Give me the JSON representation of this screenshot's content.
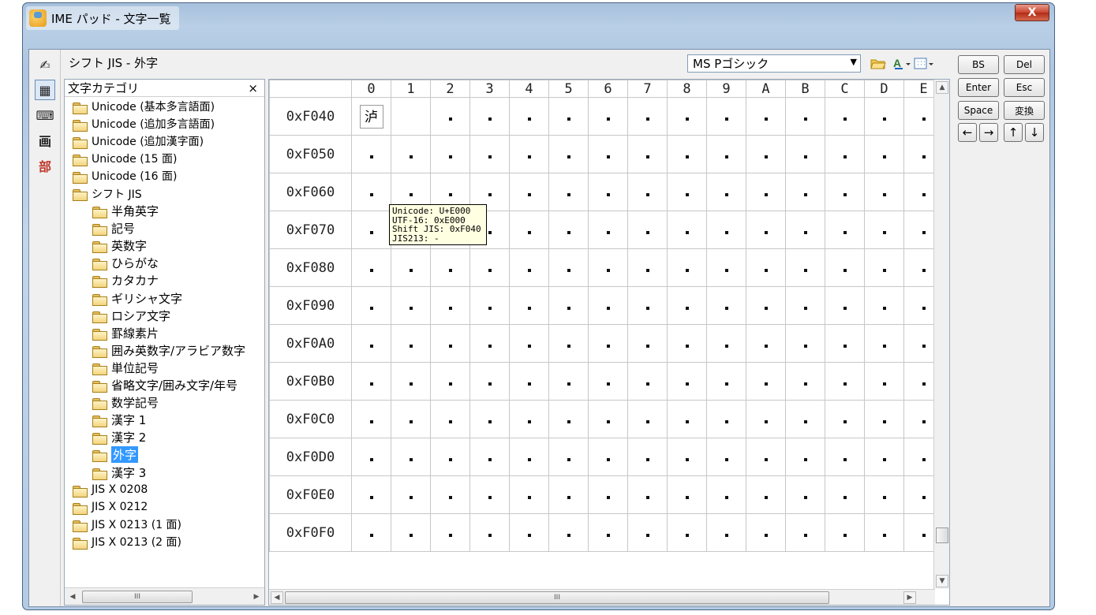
{
  "window": {
    "title": "IME パッド - 文字一覧",
    "close_label": "X"
  },
  "mode_bar": [
    {
      "name": "handwriting-mode-icon",
      "glyph": "✍"
    },
    {
      "name": "charlist-mode-icon",
      "glyph": "▦"
    },
    {
      "name": "softkeyboard-mode-icon",
      "glyph": "⌨"
    },
    {
      "name": "stroke-mode-icon",
      "glyph": "画"
    },
    {
      "name": "radical-mode-icon",
      "glyph": "部"
    }
  ],
  "header": {
    "breadcrumb": "シフト JIS - 外字",
    "font_select": "MS Pゴシック"
  },
  "category_panel": {
    "title": "文字カテゴリ",
    "close": "×",
    "items": [
      {
        "label": "Unicode (基本多言語面)",
        "level": 1
      },
      {
        "label": "Unicode (追加多言語面)",
        "level": 1
      },
      {
        "label": "Unicode (追加漢字面)",
        "level": 1
      },
      {
        "label": "Unicode (15 面)",
        "level": 1
      },
      {
        "label": "Unicode (16 面)",
        "level": 1
      },
      {
        "label": "シフト JIS",
        "level": 1
      },
      {
        "label": "半角英字",
        "level": 2
      },
      {
        "label": "記号",
        "level": 2
      },
      {
        "label": "英数字",
        "level": 2
      },
      {
        "label": "ひらがな",
        "level": 2
      },
      {
        "label": "カタカナ",
        "level": 2
      },
      {
        "label": "ギリシャ文字",
        "level": 2
      },
      {
        "label": "ロシア文字",
        "level": 2
      },
      {
        "label": "罫線素片",
        "level": 2
      },
      {
        "label": "囲み英数字/アラビア数字",
        "level": 2
      },
      {
        "label": "単位記号",
        "level": 2
      },
      {
        "label": "省略文字/囲み文字/年号",
        "level": 2
      },
      {
        "label": "数学記号",
        "level": 2
      },
      {
        "label": "漢字 1",
        "level": 2
      },
      {
        "label": "漢字 2",
        "level": 2
      },
      {
        "label": "外字",
        "level": 2,
        "selected": true
      },
      {
        "label": "漢字 3",
        "level": 2
      },
      {
        "label": "JIS X 0208",
        "level": 1
      },
      {
        "label": "JIS X 0212",
        "level": 1
      },
      {
        "label": "JIS X 0213 (1 面)",
        "level": 1
      },
      {
        "label": "JIS X 0213 (2 面)",
        "level": 1
      }
    ],
    "scroll_thumb": "III"
  },
  "grid": {
    "columns": [
      "0",
      "1",
      "2",
      "3",
      "4",
      "5",
      "6",
      "7",
      "8",
      "9",
      "A",
      "B",
      "C",
      "D",
      "E"
    ],
    "rows": [
      "0xF040",
      "0xF050",
      "0xF060",
      "0xF070",
      "0xF080",
      "0xF090",
      "0xF0A0",
      "0xF0B0",
      "0xF0C0",
      "0xF0D0",
      "0xF0E0",
      "0xF0F0"
    ],
    "first_char": "泸",
    "scroll_thumb": "III"
  },
  "tooltip": {
    "lines": [
      "Unicode: U+E000",
      "UTF-16: 0xE000",
      "Shift JIS: 0xF040",
      "JIS213: -"
    ]
  },
  "keypad": {
    "bs": "BS",
    "del": "Del",
    "enter": "Enter",
    "esc": "Esc",
    "space": "Space",
    "convert": "変換",
    "left": "←",
    "right": "→",
    "up": "↑",
    "down": "↓"
  },
  "colors": {
    "selection": "#3399ff",
    "tooltip_bg": "#ffffe1",
    "window_frame": "#b9cfe6"
  }
}
